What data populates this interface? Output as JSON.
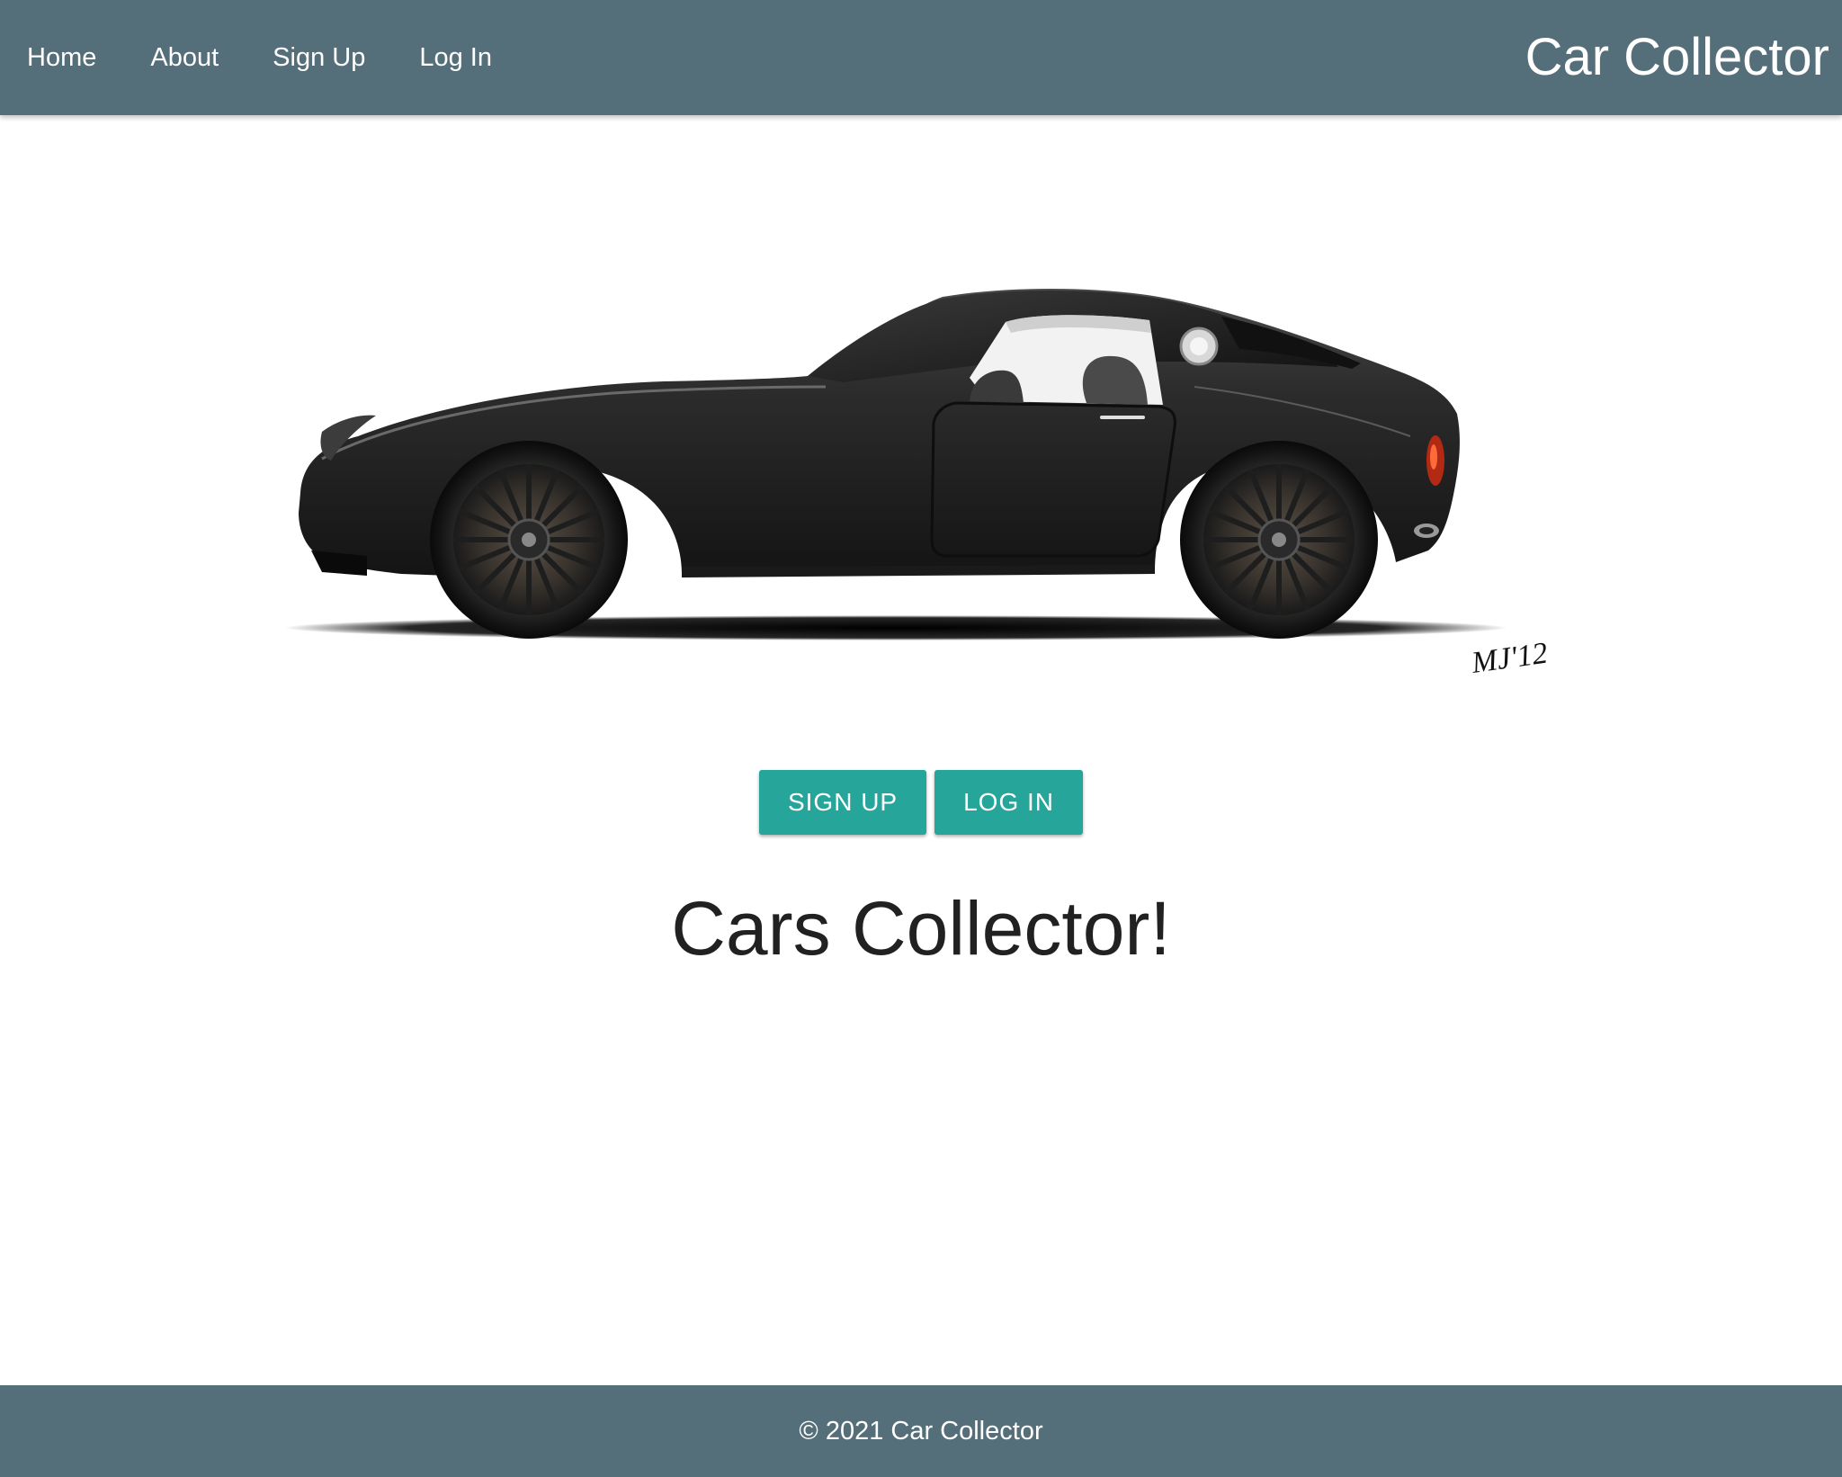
{
  "colors": {
    "nav_bg": "#546e7a",
    "accent": "#26a69a",
    "text": "#212121"
  },
  "nav": {
    "links": [
      "Home",
      "About",
      "Sign Up",
      "Log In"
    ],
    "brand": "Car Collector"
  },
  "hero": {
    "image": "black-sports-coupe-illustration",
    "signature": "MJ'12"
  },
  "actions": {
    "signup_label": "SIGN UP",
    "login_label": "LOG IN"
  },
  "main": {
    "title": "Cars Collector!"
  },
  "footer": {
    "text": "© 2021 Car Collector"
  }
}
